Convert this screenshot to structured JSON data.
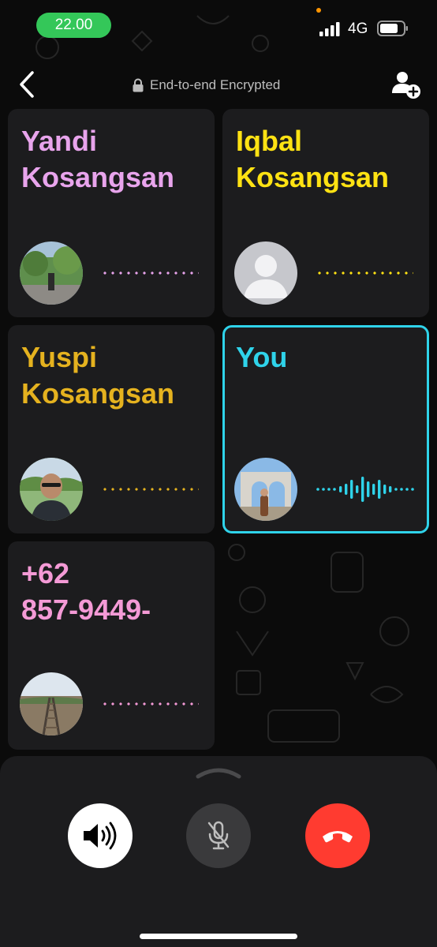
{
  "status_bar": {
    "time": "22.00",
    "network": "4G",
    "time_pill_color": "#34c759"
  },
  "header": {
    "encryption_label": "End-to-end Encrypted",
    "back_icon": "chevron-left-icon",
    "add_icon": "add-participant-icon"
  },
  "participants": [
    {
      "name": "Yandi\nKosangsan",
      "color": "#e8a4ec",
      "speaking": false
    },
    {
      "name": "Iqbal\nKosangsan",
      "color": "#ffe213",
      "speaking": false
    },
    {
      "name": "Yuspi\nKosangsan",
      "color": "#e5b21f",
      "speaking": false
    },
    {
      "name": "You",
      "color": "#2fd3ea",
      "speaking": true
    },
    {
      "name": "+62\n857-9449-",
      "color": "#f49ad6",
      "speaking": false
    }
  ],
  "controls": {
    "speaker_icon": "speaker-icon",
    "mute_icon": "microphone-muted-icon",
    "end_call_icon": "end-call-icon",
    "end_call_color": "#ff3b30"
  }
}
